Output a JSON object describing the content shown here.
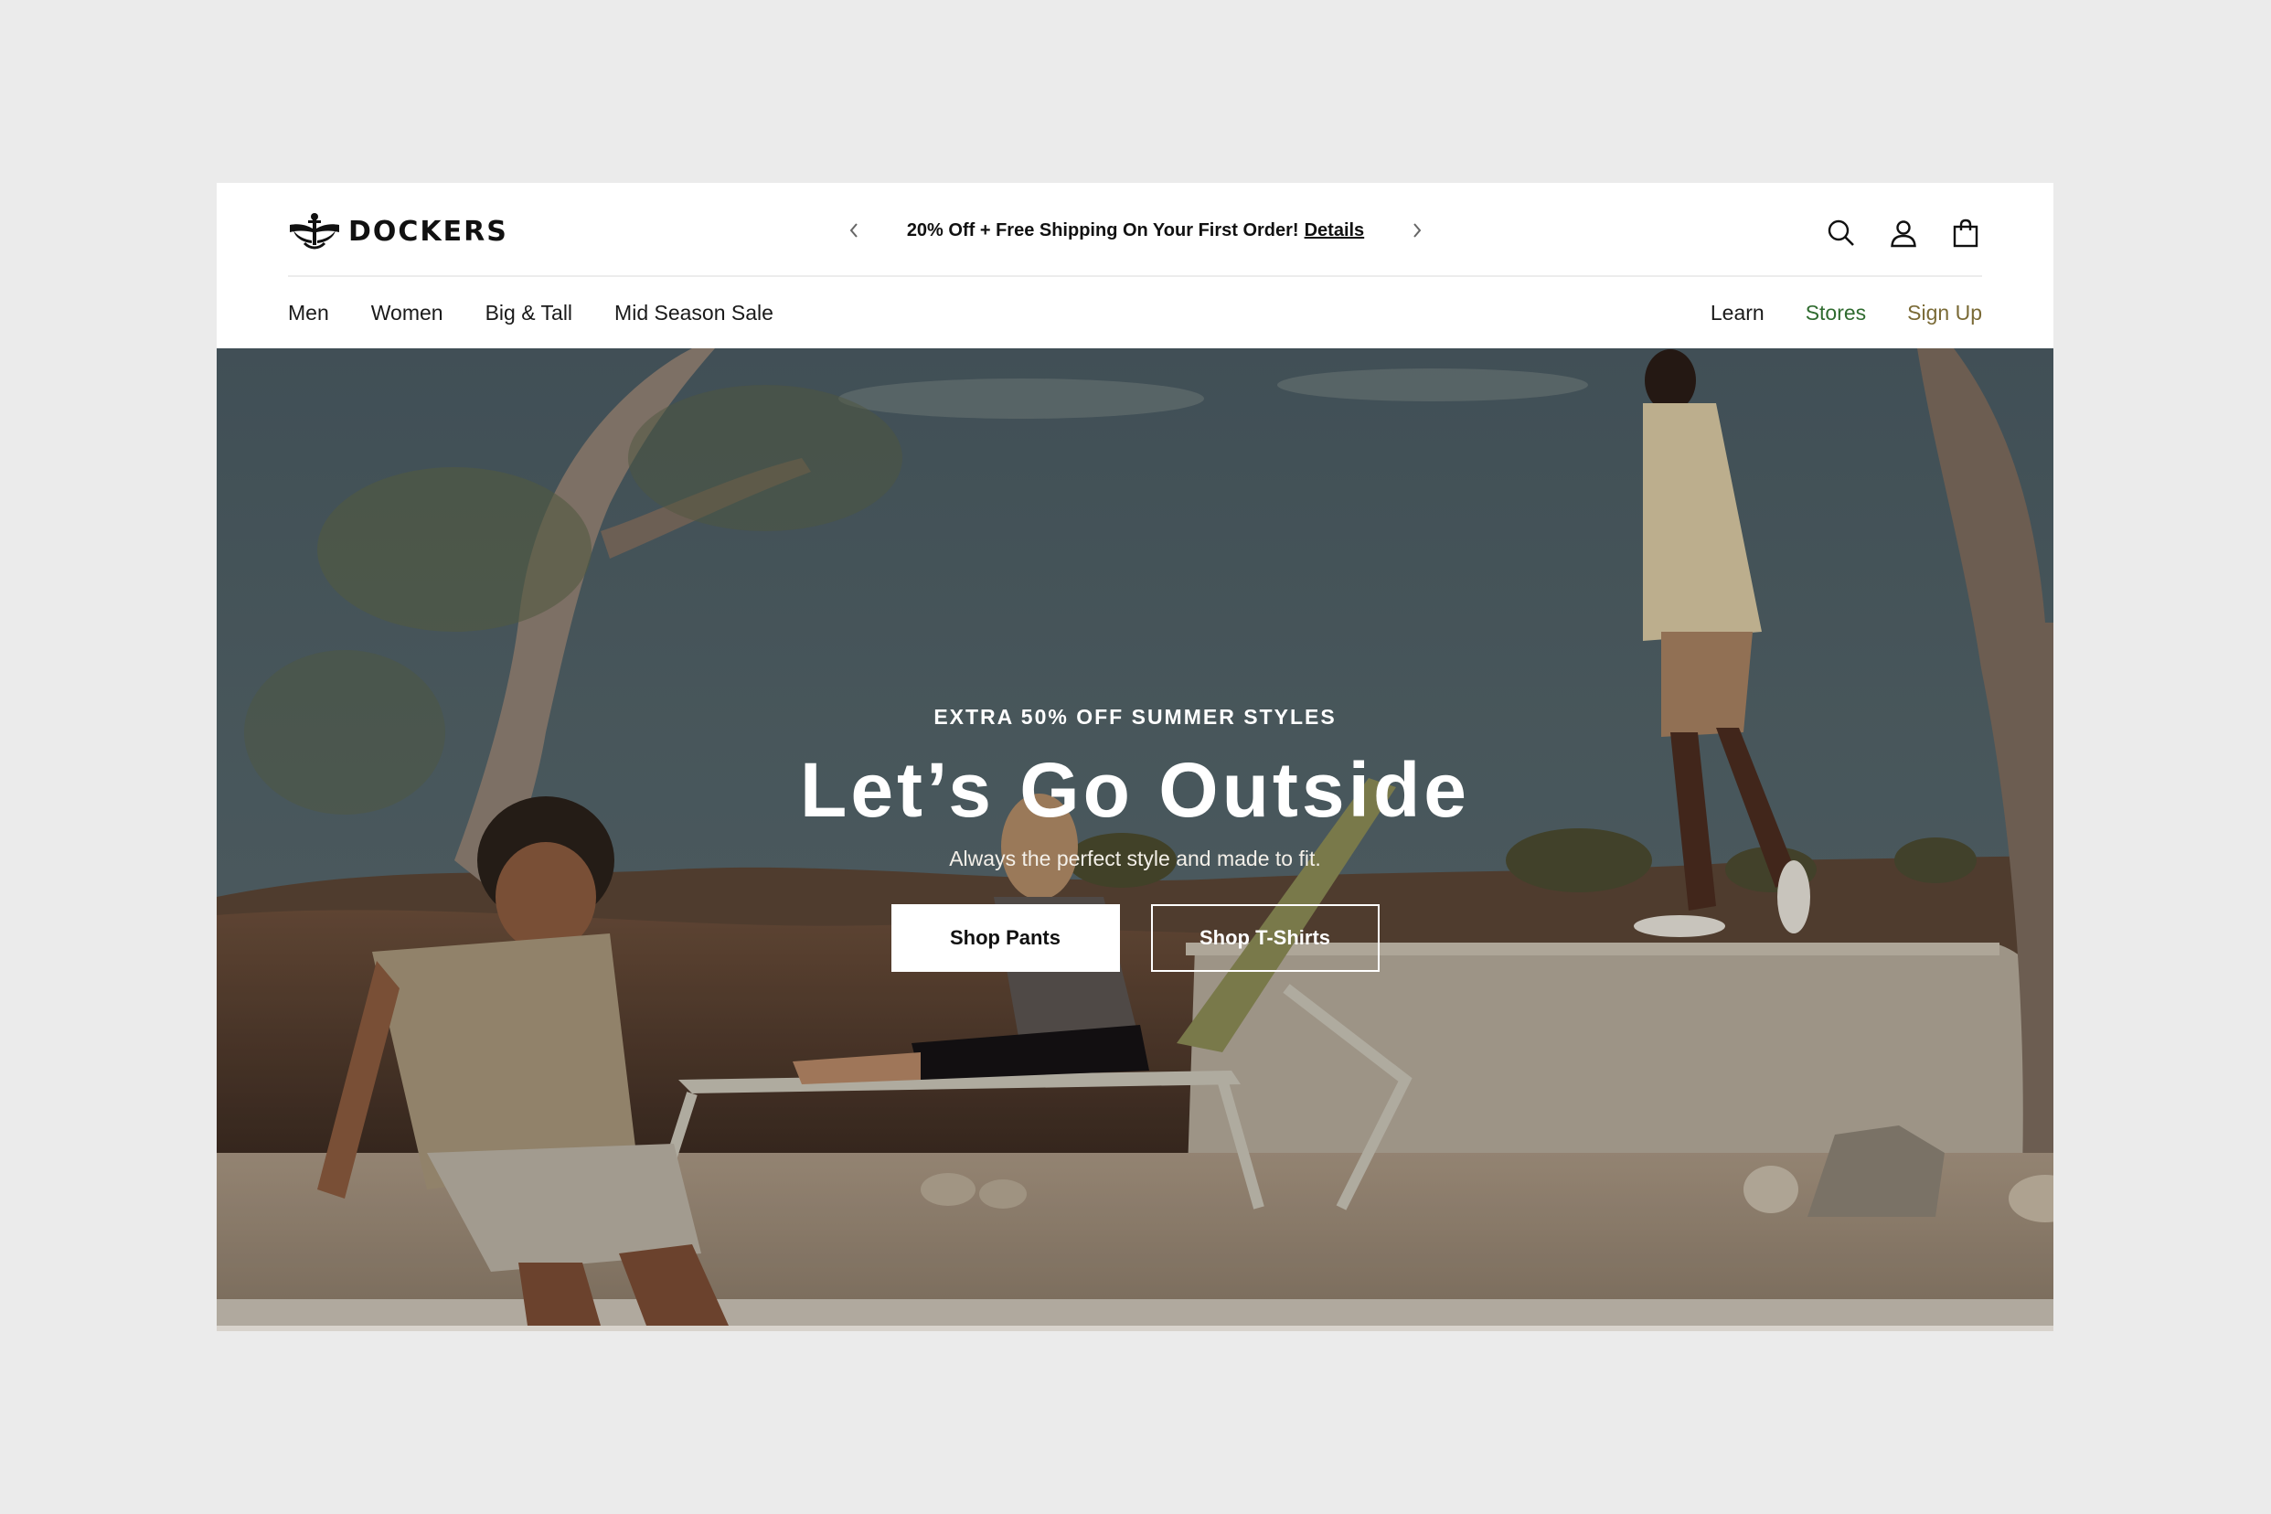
{
  "brand": {
    "name": "DOCKERS",
    "logo_icon": "anchor-wings-logo"
  },
  "promo": {
    "text": "20% Off + Free Shipping On Your First Order!",
    "link": "Details",
    "prev_icon": "chevron-left-icon",
    "next_icon": "chevron-right-icon"
  },
  "utility": {
    "icons": [
      "search-icon",
      "account-icon",
      "shopping-bag-icon"
    ]
  },
  "nav": {
    "left": [
      "Men",
      "Women",
      "Big & Tall",
      "Mid Season Sale"
    ],
    "right": [
      {
        "label": "Learn",
        "color": "#1a1a1a"
      },
      {
        "label": "Stores",
        "color": "#2f6b2f"
      },
      {
        "label": "Sign Up",
        "color": "#7a6a36"
      }
    ]
  },
  "hero": {
    "eyebrow": "EXTRA 50% OFF SUMMER STYLES",
    "headline": "Let’s Go Outside",
    "subline": "Always the perfect style and made to fit.",
    "cta_primary": "Shop Pants",
    "cta_secondary": "Shop T-Shirts"
  },
  "colors": {
    "page_background": "#ebebeb",
    "header_background": "#ffffff",
    "text": "#111111",
    "stores_link": "#2f6b2f",
    "signup_link": "#7a6a36"
  }
}
